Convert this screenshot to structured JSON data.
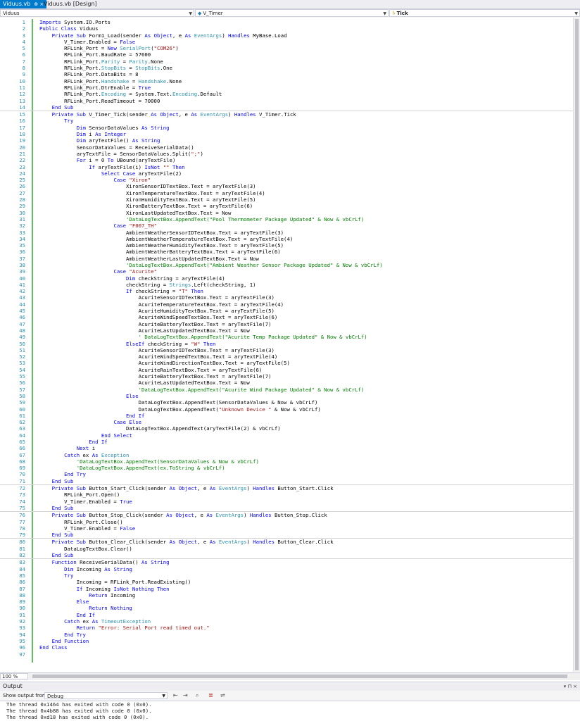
{
  "tabs": [
    {
      "label": "Viduus.vb",
      "active": true,
      "icons": "⊕ × "
    },
    {
      "label": "Viduus.vb [Design]",
      "active": false,
      "icons": ""
    }
  ],
  "navbar": {
    "project": "Viduus",
    "object": "V_Timer",
    "event": "Tick"
  },
  "code_lines": [
    {
      "n": "1",
      "code": "Imports System.IO.Ports"
    },
    {
      "n": "2",
      "code": "Public Class Viduus"
    },
    {
      "n": "3",
      "code": "    Private Sub Form1_Load(sender As Object, e As EventArgs) Handles MyBase.Load"
    },
    {
      "n": "4",
      "code": "        V_Timer.Enabled = False"
    },
    {
      "n": "5",
      "code": "        RFLink_Port = New SerialPort(\"COM26\")"
    },
    {
      "n": "6",
      "code": "        RFLink_Port.BaudRate = 57600"
    },
    {
      "n": "7",
      "code": "        RFLink_Port.Parity = Parity.None"
    },
    {
      "n": "8",
      "code": "        RFLink_Port.StopBits = StopBits.One"
    },
    {
      "n": "9",
      "code": "        RFLink_Port.DataBits = 8"
    },
    {
      "n": "10",
      "code": "        RFLink_Port.Handshake = Handshake.None"
    },
    {
      "n": "11",
      "code": "        RFLink_Port.DtrEnable = True"
    },
    {
      "n": "12",
      "code": "        RFLink_Port.Encoding = System.Text.Encoding.Default"
    },
    {
      "n": "13",
      "code": "        RFLink_Port.ReadTimeout = 70000"
    },
    {
      "n": "14",
      "code": "    End Sub"
    },
    {
      "n": "15",
      "code": "    Private Sub V_Timer_Tick(sender As Object, e As EventArgs) Handles V_Timer.Tick"
    },
    {
      "n": "16",
      "code": "        Try"
    },
    {
      "n": "17",
      "code": "            Dim SensorDataValues As String"
    },
    {
      "n": "18",
      "code": "            Dim i As Integer"
    },
    {
      "n": "19",
      "code": "            Dim aryTextFile() As String"
    },
    {
      "n": "20",
      "code": "            SensorDataValues = ReceiveSerialData()"
    },
    {
      "n": "21",
      "code": "            aryTextFile = SensorDataValues.Split(\";\")"
    },
    {
      "n": "22",
      "code": "            For i = 0 To UBound(aryTextFile)"
    },
    {
      "n": "23",
      "code": "                If aryTextFile(i) IsNot \"\" Then"
    },
    {
      "n": "24",
      "code": "                    Select Case aryTextFile(2)"
    },
    {
      "n": "25",
      "code": "                        Case \"Xiron\""
    },
    {
      "n": "26",
      "code": "                            XironSensorIDTextBox.Text = aryTextFile(3)"
    },
    {
      "n": "27",
      "code": "                            XironTemperatureTextBox.Text = aryTextFile(4)"
    },
    {
      "n": "28",
      "code": "                            XironHumidityTextBox.Text = aryTextFile(5)"
    },
    {
      "n": "29",
      "code": "                            XironBatteryTextBox.Text = aryTextFile(6)"
    },
    {
      "n": "30",
      "code": "                            XironLastUpdatedTextBox.Text = Now"
    },
    {
      "n": "31",
      "code": "                            'DataLogTextBox.AppendText(\"Pool Thermometer Package Updated\" & Now & vbCrLf)"
    },
    {
      "n": "32",
      "code": "                        Case \"F007_TH\""
    },
    {
      "n": "33",
      "code": "                            AmbientWeatherSensorIDTextBox.Text = aryTextFile(3)"
    },
    {
      "n": "34",
      "code": "                            AmbientWeatherTemperatureTextBox.Text = aryTextFile(4)"
    },
    {
      "n": "35",
      "code": "                            AmbientWeatherHumidityTextBox.Text = aryTextFile(5)"
    },
    {
      "n": "36",
      "code": "                            AmbientWeatherBatteryTextBox.Text = aryTextFile(6)"
    },
    {
      "n": "37",
      "code": "                            AmbientWeatherLastUpdatedTextBox.Text = Now"
    },
    {
      "n": "38",
      "code": "                            'DataLogTextBox.AppendText(\"Ambient Weather Sensor Package Updated\" & Now & vbCrLf)"
    },
    {
      "n": "39",
      "code": "                        Case \"Acurite\""
    },
    {
      "n": "40",
      "code": "                            Dim checkString = aryTextFile(4)"
    },
    {
      "n": "41",
      "code": "                            checkString = Strings.Left(checkString, 1)"
    },
    {
      "n": "42",
      "code": "                            If checkString = \"T\" Then"
    },
    {
      "n": "43",
      "code": "                                AcuriteSensorIDTextBox.Text = aryTextFile(3)"
    },
    {
      "n": "44",
      "code": "                                AcuriteTemperatureTextBox.Text = aryTextFile(4)"
    },
    {
      "n": "45",
      "code": "                                AcuriteHumidityTextBox.Text = aryTextFile(5)"
    },
    {
      "n": "46",
      "code": "                                AcuriteWindSpeedTextBox.Text = aryTextFile(6)"
    },
    {
      "n": "47",
      "code": "                                AcuriteBatteryTextBox.Text = aryTextFile(7)"
    },
    {
      "n": "48",
      "code": "                                AcuriteLastUpdatedTextBox.Text = Now"
    },
    {
      "n": "49",
      "code": "                                ' DataLogTextBox.AppendText(\"Acurite Temp Package Updated\" & Now & vbCrLf)"
    },
    {
      "n": "50",
      "code": "                            ElseIf checkString = \"W\" Then"
    },
    {
      "n": "51",
      "code": "                                AcuriteSensorIDTextBox.Text = aryTextFile(3)"
    },
    {
      "n": "52",
      "code": "                                AcuriteWindSpeedTextBox.Text = aryTextFile(4)"
    },
    {
      "n": "53",
      "code": "                                AcuriteWindDirectionTextBox.Text = aryTextFile(5)"
    },
    {
      "n": "54",
      "code": "                                AcuriteRainTextBox.Text = aryTextFile(6)"
    },
    {
      "n": "55",
      "code": "                                AcuriteBatteryTextBox.Text = aryTextFile(7)"
    },
    {
      "n": "56",
      "code": "                                AcuriteLastUpdatedTextBox.Text = Now"
    },
    {
      "n": "57",
      "code": "                                'DataLogTextBox.AppendText(\"Acurite Wind Package Updated\" & Now & vbCrLf)"
    },
    {
      "n": "58",
      "code": "                            Else"
    },
    {
      "n": "59",
      "code": "                                DataLogTextBox.AppendText(SensorDataValues & Now & vbCrLf)"
    },
    {
      "n": "60",
      "code": "                                DataLogTextBox.AppendText(\"Unknown Device \" & Now & vbCrLf)"
    },
    {
      "n": "61",
      "code": "                            End If"
    },
    {
      "n": "62",
      "code": "                        Case Else"
    },
    {
      "n": "63",
      "code": "                            DataLogTextBox.AppendText(aryTextFile(2) & vbCrLf)"
    },
    {
      "n": "64",
      "code": "                    End Select"
    },
    {
      "n": "65",
      "code": "                End If"
    },
    {
      "n": "66",
      "code": "            Next i"
    },
    {
      "n": "67",
      "code": "        Catch ex As Exception"
    },
    {
      "n": "68",
      "code": "            'DataLogTextBox.AppendText(SensorDataValues & Now & vbCrLf)"
    },
    {
      "n": "69",
      "code": "            'DataLogTextBox.AppendText(ex.ToString & vbCrLf)"
    },
    {
      "n": "70",
      "code": "        End Try"
    },
    {
      "n": "71",
      "code": "    End Sub"
    },
    {
      "n": "72",
      "code": "    Private Sub Button_Start_Click(sender As Object, e As EventArgs) Handles Button_Start.Click"
    },
    {
      "n": "73",
      "code": "        RFLink_Port.Open()"
    },
    {
      "n": "74",
      "code": "        V_Timer.Enabled = True"
    },
    {
      "n": "75",
      "code": "    End Sub"
    },
    {
      "n": "76",
      "code": "    Private Sub Button_Stop_Click(sender As Object, e As EventArgs) Handles Button_Stop.Click"
    },
    {
      "n": "77",
      "code": "        RFLink_Port.Close()"
    },
    {
      "n": "78",
      "code": "        V_Timer.Enabled = False"
    },
    {
      "n": "79",
      "code": "    End Sub"
    },
    {
      "n": "80",
      "code": "    Private Sub Button_Clear_Click(sender As Object, e As EventArgs) Handles Button_Clear.Click"
    },
    {
      "n": "81",
      "code": "        DataLogTextBox.Clear()"
    },
    {
      "n": "82",
      "code": "    End Sub"
    },
    {
      "n": "83",
      "code": "    Function ReceiveSerialData() As String"
    },
    {
      "n": "84",
      "code": "        Dim Incoming As String"
    },
    {
      "n": "85",
      "code": "        Try"
    },
    {
      "n": "86",
      "code": "            Incoming = RFLink_Port.ReadExisting()"
    },
    {
      "n": "87",
      "code": "            If Incoming IsNot Nothing Then"
    },
    {
      "n": "88",
      "code": "                Return Incoming"
    },
    {
      "n": "89",
      "code": "            Else"
    },
    {
      "n": "90",
      "code": "                Return Nothing"
    },
    {
      "n": "91",
      "code": "            End If"
    },
    {
      "n": "92",
      "code": "        Catch ex As TimeoutException"
    },
    {
      "n": "93",
      "code": "            Return \"Error: Serial Port read timed out.\""
    },
    {
      "n": "94",
      "code": "        End Try"
    },
    {
      "n": "95",
      "code": "    End Function"
    },
    {
      "n": "96",
      "code": "End Class"
    },
    {
      "n": "97",
      "code": ""
    }
  ],
  "zoom": "100 %",
  "output": {
    "title": "Output",
    "controls": "▾ ⊓ ×",
    "show_from_label": "Show output from:",
    "source": "Debug",
    "lines": [
      "The thread 0x1464 has exited with code 0 (0x0).",
      "The thread 0x4b88 has exited with code 0 (0x0).",
      "The thread 0xd18 has exited with code 0 (0x0)."
    ]
  },
  "colors": {
    "keyword": "#0000ff",
    "type": "#2b91af",
    "string": "#a31515",
    "comment": "#008000",
    "active_tab": "#007acc",
    "change_bar": "#5ec05e"
  }
}
